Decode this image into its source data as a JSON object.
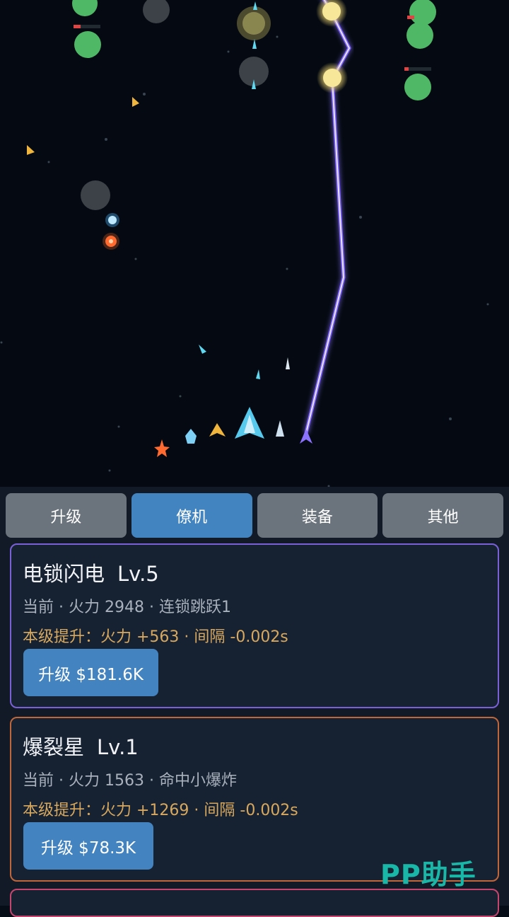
{
  "tabs": [
    {
      "label": "升级",
      "active": false
    },
    {
      "label": "僚机",
      "active": true
    },
    {
      "label": "装备",
      "active": false
    },
    {
      "label": "其他",
      "active": false
    }
  ],
  "cards": [
    {
      "name": "电锁闪电",
      "level": "Lv.5",
      "current": "当前 · 火力 2948 · 连锁跳跃1",
      "upgrade": "本级提升：火力 +563 · 间隔 -0.002s",
      "button": "升级 $181.6K",
      "border_color": "#7a61d8"
    },
    {
      "name": "爆裂星",
      "level": "Lv.1",
      "current": "当前 · 火力 1563 · 命中小爆炸",
      "upgrade": "本级提升：火力 +1269 · 间隔 -0.002s",
      "button": "升级 $78.3K",
      "border_color": "#c0663b"
    }
  ],
  "watermark": "PP助手",
  "colors": {
    "accent": "#4284bf",
    "lightning": "#8a72ff",
    "enemy": "#4fb866",
    "upgrade_text": "#d7a85e"
  }
}
